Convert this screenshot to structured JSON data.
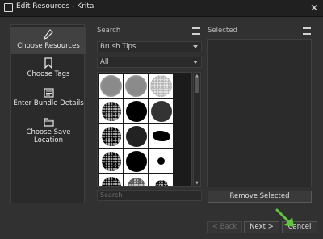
{
  "window": {
    "title": "Edit Resources - Krita"
  },
  "nav": {
    "items": [
      {
        "label": "Choose Resources",
        "icon": "pencil-icon"
      },
      {
        "label": "Choose Tags",
        "icon": "bookmark-icon"
      },
      {
        "label": "Enter Bundle Details",
        "icon": "details-icon"
      },
      {
        "label": "Choose Save Location",
        "icon": "folder-icon"
      }
    ]
  },
  "search_panel": {
    "header": "Search",
    "type_combo": "Brush Tips",
    "filter_combo": "All",
    "search_placeholder": "Search"
  },
  "selected_panel": {
    "header": "Selected",
    "remove_label": "Remove Selected"
  },
  "buttons": {
    "back": "< Back",
    "next": "Next >",
    "cancel": "Cancel"
  },
  "colors": {
    "annotation_arrow": "#5cc83a"
  }
}
